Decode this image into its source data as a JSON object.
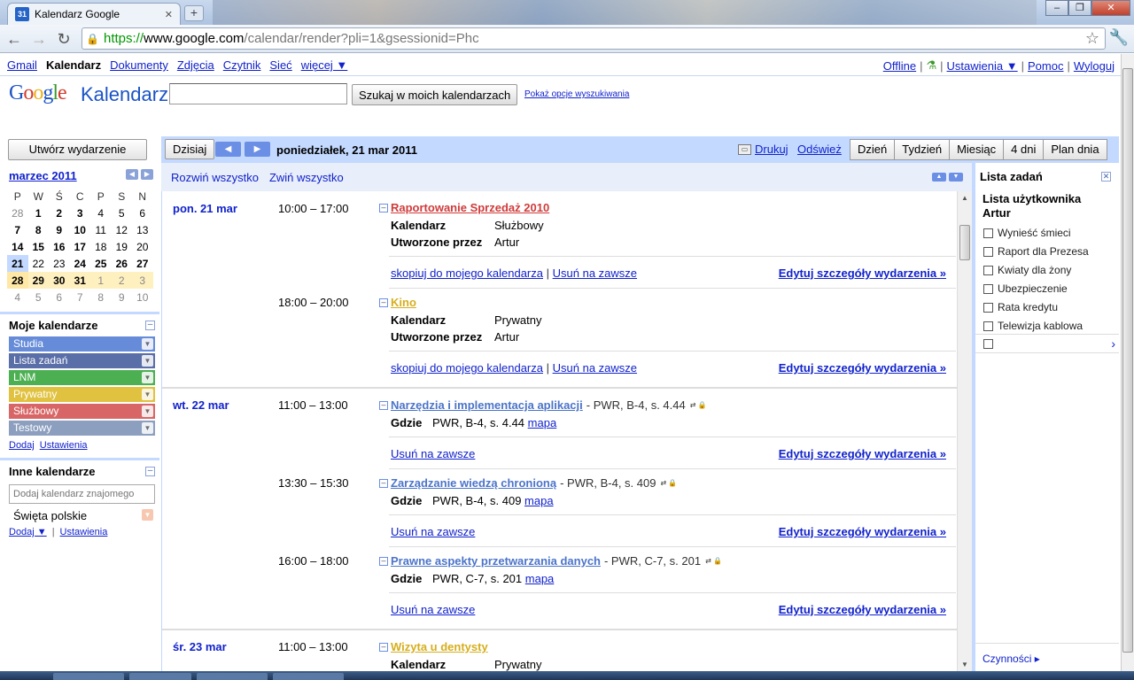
{
  "browser": {
    "tab_title": "Kalendarz Google",
    "tab_favicon_text": "31",
    "url_scheme": "https://",
    "url_host": "www.google.com",
    "url_path": "/calendar/render?pli=1&gsessionid=Phc"
  },
  "gbar": {
    "apps": [
      "Gmail",
      "Kalendarz",
      "Dokumenty",
      "Zdjęcia",
      "Czytnik",
      "Sieć",
      "więcej ▼"
    ],
    "right": [
      "Offline",
      "Ustawienia ▼",
      "Pomoc",
      "Wyloguj"
    ]
  },
  "header": {
    "product": "Kalendarz",
    "search_button": "Szukaj w moich kalendarzach",
    "search_options": "Pokaż opcje wyszukiwania"
  },
  "left": {
    "create_button": "Utwórz wydarzenie",
    "month_title": "marzec 2011",
    "weekdays": [
      "P",
      "W",
      "Ś",
      "C",
      "P",
      "S",
      "N"
    ],
    "weeks": [
      [
        "28",
        "1",
        "2",
        "3",
        "4",
        "5",
        "6"
      ],
      [
        "7",
        "8",
        "9",
        "10",
        "11",
        "12",
        "13"
      ],
      [
        "14",
        "15",
        "16",
        "17",
        "18",
        "19",
        "20"
      ],
      [
        "21",
        "22",
        "23",
        "24",
        "25",
        "26",
        "27"
      ],
      [
        "28",
        "29",
        "30",
        "31",
        "1",
        "2",
        "3"
      ],
      [
        "4",
        "5",
        "6",
        "7",
        "8",
        "9",
        "10"
      ]
    ],
    "my_calendars_title": "Moje kalendarze",
    "my_calendars": [
      {
        "name": "Studia",
        "color": "#668cd9"
      },
      {
        "name": "Lista zadań",
        "color": "#5a6ea8"
      },
      {
        "name": "LNM",
        "color": "#4cb052"
      },
      {
        "name": "Prywatny",
        "color": "#e0c240"
      },
      {
        "name": "Służbowy",
        "color": "#d96666"
      },
      {
        "name": "Testowy",
        "color": "#8c9fbf"
      }
    ],
    "my_links": [
      "Dodaj",
      "Ustawienia"
    ],
    "other_calendars_title": "Inne kalendarze",
    "add_friend_placeholder": "Dodaj kalendarz znajomego",
    "holiday_calendar": "Święta polskie",
    "other_links": [
      "Dodaj ▼",
      "Ustawienia"
    ]
  },
  "toolbar": {
    "today": "Dzisiaj",
    "current_date": "poniedziałek, 21 mar 2011",
    "print": "Drukuj",
    "refresh": "Odśwież",
    "views": [
      "Dzień",
      "Tydzień",
      "Miesiąc",
      "4 dni",
      "Plan dnia"
    ]
  },
  "agenda": {
    "expand_all": "Rozwiń wszystko",
    "collapse_all": "Zwiń wszystko",
    "days": [
      {
        "label": "pon. 21 mar",
        "events": [
          {
            "time": "10:00 – 17:00",
            "title": "Raportowanie Sprzedaż 2010",
            "color": "#d03b3b",
            "location": "",
            "rows": [
              [
                "Kalendarz",
                "Służbowy"
              ],
              [
                "Utworzone przez",
                "Artur"
              ]
            ],
            "actions": [
              "skopiuj do mojego kalendarza",
              "Usuń na zawsze"
            ],
            "edit": "Edytuj szczegóły wydarzenia »"
          },
          {
            "time": "18:00 – 20:00",
            "title": "Kino",
            "color": "#d6ae1c",
            "location": "",
            "rows": [
              [
                "Kalendarz",
                "Prywatny"
              ],
              [
                "Utworzone przez",
                "Artur"
              ]
            ],
            "actions": [
              "skopiuj do mojego kalendarza",
              "Usuń na zawsze"
            ],
            "edit": "Edytuj szczegóły wydarzenia »"
          }
        ]
      },
      {
        "label": "wt. 22 mar",
        "events": [
          {
            "time": "11:00 – 13:00",
            "title": "Narzędzia i implementacja aplikacji",
            "color": "#4b74c9",
            "location": "- PWR, B-4, s. 4.44",
            "where_label": "Gdzie",
            "where": "PWR, B-4, s. 4.44",
            "map": "mapa",
            "actions": [
              "Usuń na zawsze"
            ],
            "edit": "Edytuj szczegóły wydarzenia »"
          },
          {
            "time": "13:30 – 15:30",
            "title": "Zarządzanie wiedzą chronioną",
            "color": "#4b74c9",
            "location": "- PWR, B-4, s. 409",
            "where_label": "Gdzie",
            "where": "PWR, B-4, s. 409",
            "map": "mapa",
            "actions": [
              "Usuń na zawsze"
            ],
            "edit": "Edytuj szczegóły wydarzenia »"
          },
          {
            "time": "16:00 – 18:00",
            "title": "Prawne aspekty przetwarzania danych",
            "color": "#4b74c9",
            "location": "- PWR, C-7, s. 201",
            "where_label": "Gdzie",
            "where": "PWR, C-7, s. 201",
            "map": "mapa",
            "actions": [
              "Usuń na zawsze"
            ],
            "edit": "Edytuj szczegóły wydarzenia »"
          }
        ]
      },
      {
        "label": "śr. 23 mar",
        "events": [
          {
            "time": "11:00 – 13:00",
            "title": "Wizyta u dentysty",
            "color": "#d6ae1c",
            "rows": [
              [
                "Kalendarz",
                "Prywatny"
              ]
            ]
          }
        ]
      }
    ]
  },
  "tasks": {
    "title": "Lista zadań",
    "owner": "Lista użytkownika Artur",
    "items": [
      "Wynieść śmieci",
      "Raport dla Prezesa",
      "Kwiaty dla żony",
      "Ubezpieczenie",
      "Rata kredytu",
      "Telewizja kablowa"
    ],
    "actions": "Czynności ▸"
  }
}
